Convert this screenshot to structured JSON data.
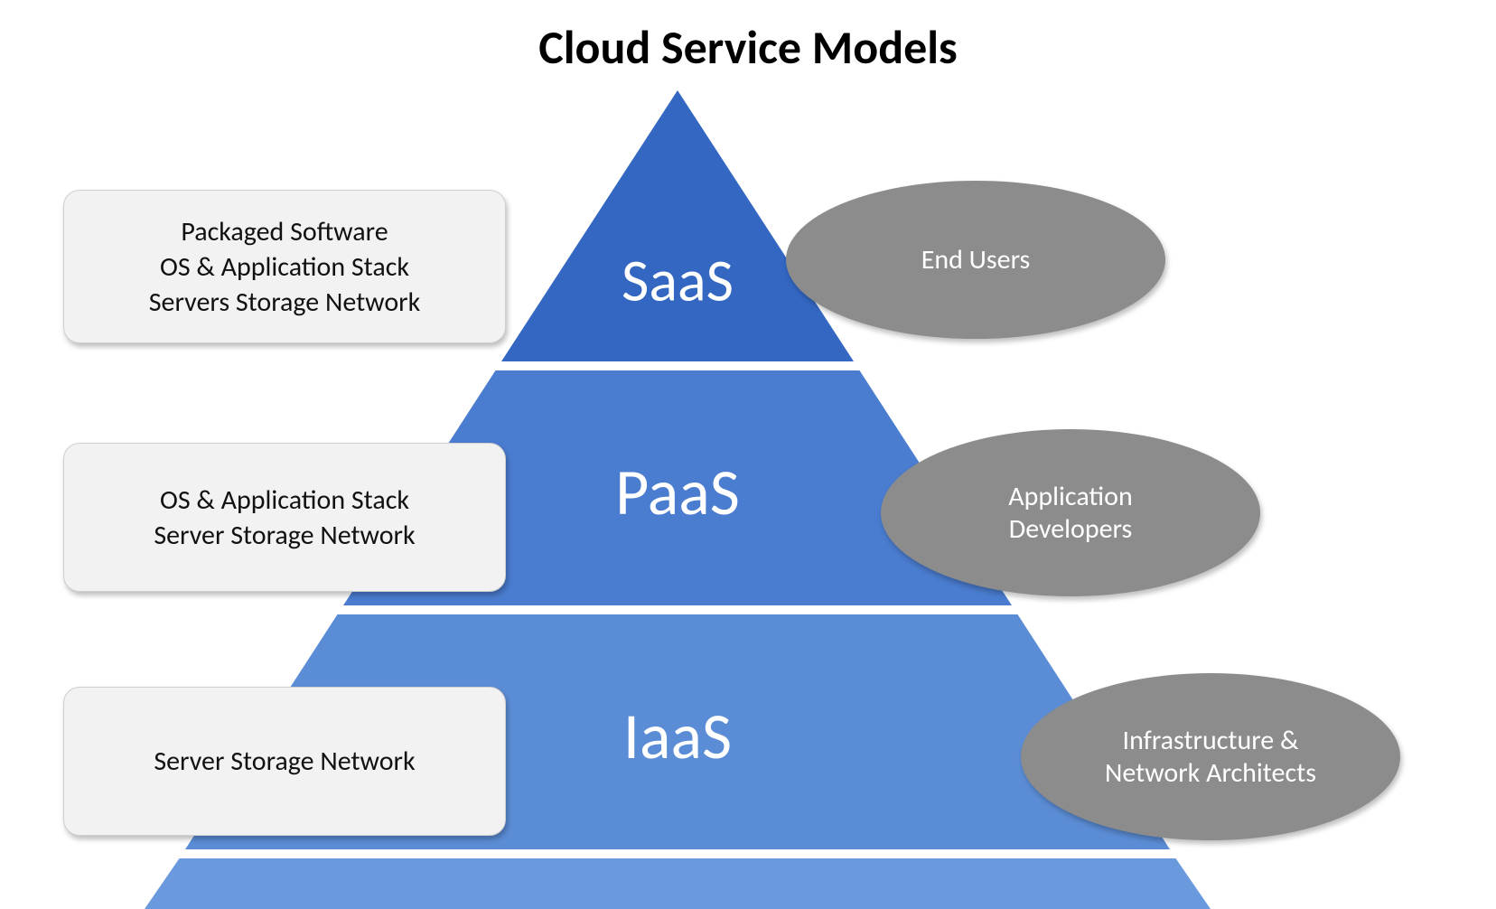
{
  "title": "Cloud Service Models",
  "tiers": [
    {
      "label": "SaaS",
      "desc": [
        "Packaged Software",
        "OS & Application Stack",
        "Servers Storage Network"
      ],
      "audience": "End Users"
    },
    {
      "label": "PaaS",
      "desc": [
        "OS & Application Stack",
        "Server Storage Network"
      ],
      "audience": "Application\nDevelopers"
    },
    {
      "label": "IaaS",
      "desc": [
        "Server Storage Network"
      ],
      "audience": "Infrastructure &\nNetwork Architects"
    }
  ],
  "colors": {
    "tier_top": "#3367c2",
    "tier_mid": "#4a7ccf",
    "tier_bot": "#5b8dd6",
    "tier_bottom_strip": "#6a99de",
    "box_bg": "#f2f2f2",
    "oval_bg": "#8c8c8c"
  }
}
